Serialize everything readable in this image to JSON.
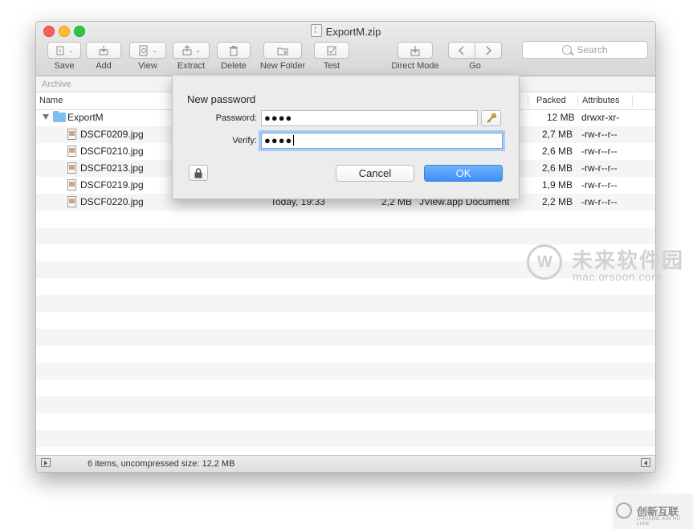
{
  "window": {
    "title": "ExportM.zip"
  },
  "toolbar": {
    "save": "Save",
    "add": "Add",
    "view": "View",
    "extract": "Extract",
    "delete": "Delete",
    "new_folder": "New Folder",
    "test": "Test",
    "direct_mode": "Direct Mode",
    "go": "Go",
    "search_placeholder": "Search"
  },
  "archive_label": "Archive",
  "columns": {
    "name": "Name",
    "packed": "Packed",
    "attributes": "Attributes"
  },
  "rows": [
    {
      "name": "ExportM",
      "modified": "",
      "size": "",
      "kind": "",
      "packed": "12 MB",
      "attributes": "drwxr-xr-"
    },
    {
      "name": "DSCF0209.jpg",
      "modified": "",
      "size": "",
      "kind": "",
      "packed": "2,7 MB",
      "attributes": "-rw-r--r--"
    },
    {
      "name": "DSCF0210.jpg",
      "modified": "",
      "size": "",
      "kind": "",
      "packed": "2,6 MB",
      "attributes": "-rw-r--r--"
    },
    {
      "name": "DSCF0213.jpg",
      "modified": "",
      "size": "",
      "kind": "",
      "packed": "2,6 MB",
      "attributes": "-rw-r--r--"
    },
    {
      "name": "DSCF0219.jpg",
      "modified": "",
      "size": "",
      "kind": "",
      "packed": "1,9 MB",
      "attributes": "-rw-r--r--"
    },
    {
      "name": "DSCF0220.jpg",
      "modified": "Today, 19:33",
      "size": "2,2 MB",
      "kind": "JView.app Document",
      "packed": "2,2 MB",
      "attributes": "-rw-r--r--"
    }
  ],
  "status": {
    "text": "6 items, uncompressed size: 12,2 MB"
  },
  "dialog": {
    "title": "New password",
    "password_label": "Password:",
    "password_value": "●●●●",
    "verify_label": "Verify:",
    "verify_value": "●●●●",
    "cancel": "Cancel",
    "ok": "OK"
  },
  "watermark": {
    "site_cn": "未来软件园",
    "site_url": "mac.orsoon.com",
    "brand_cn": "创新互联",
    "brand_sub": "CHUANG XIN HU LIAN"
  },
  "colors": {
    "accent": "#3d8ef7",
    "folder": "#7cc0ef",
    "close": "#fd5f57",
    "minimize": "#febc2e",
    "maximize": "#28c840"
  }
}
